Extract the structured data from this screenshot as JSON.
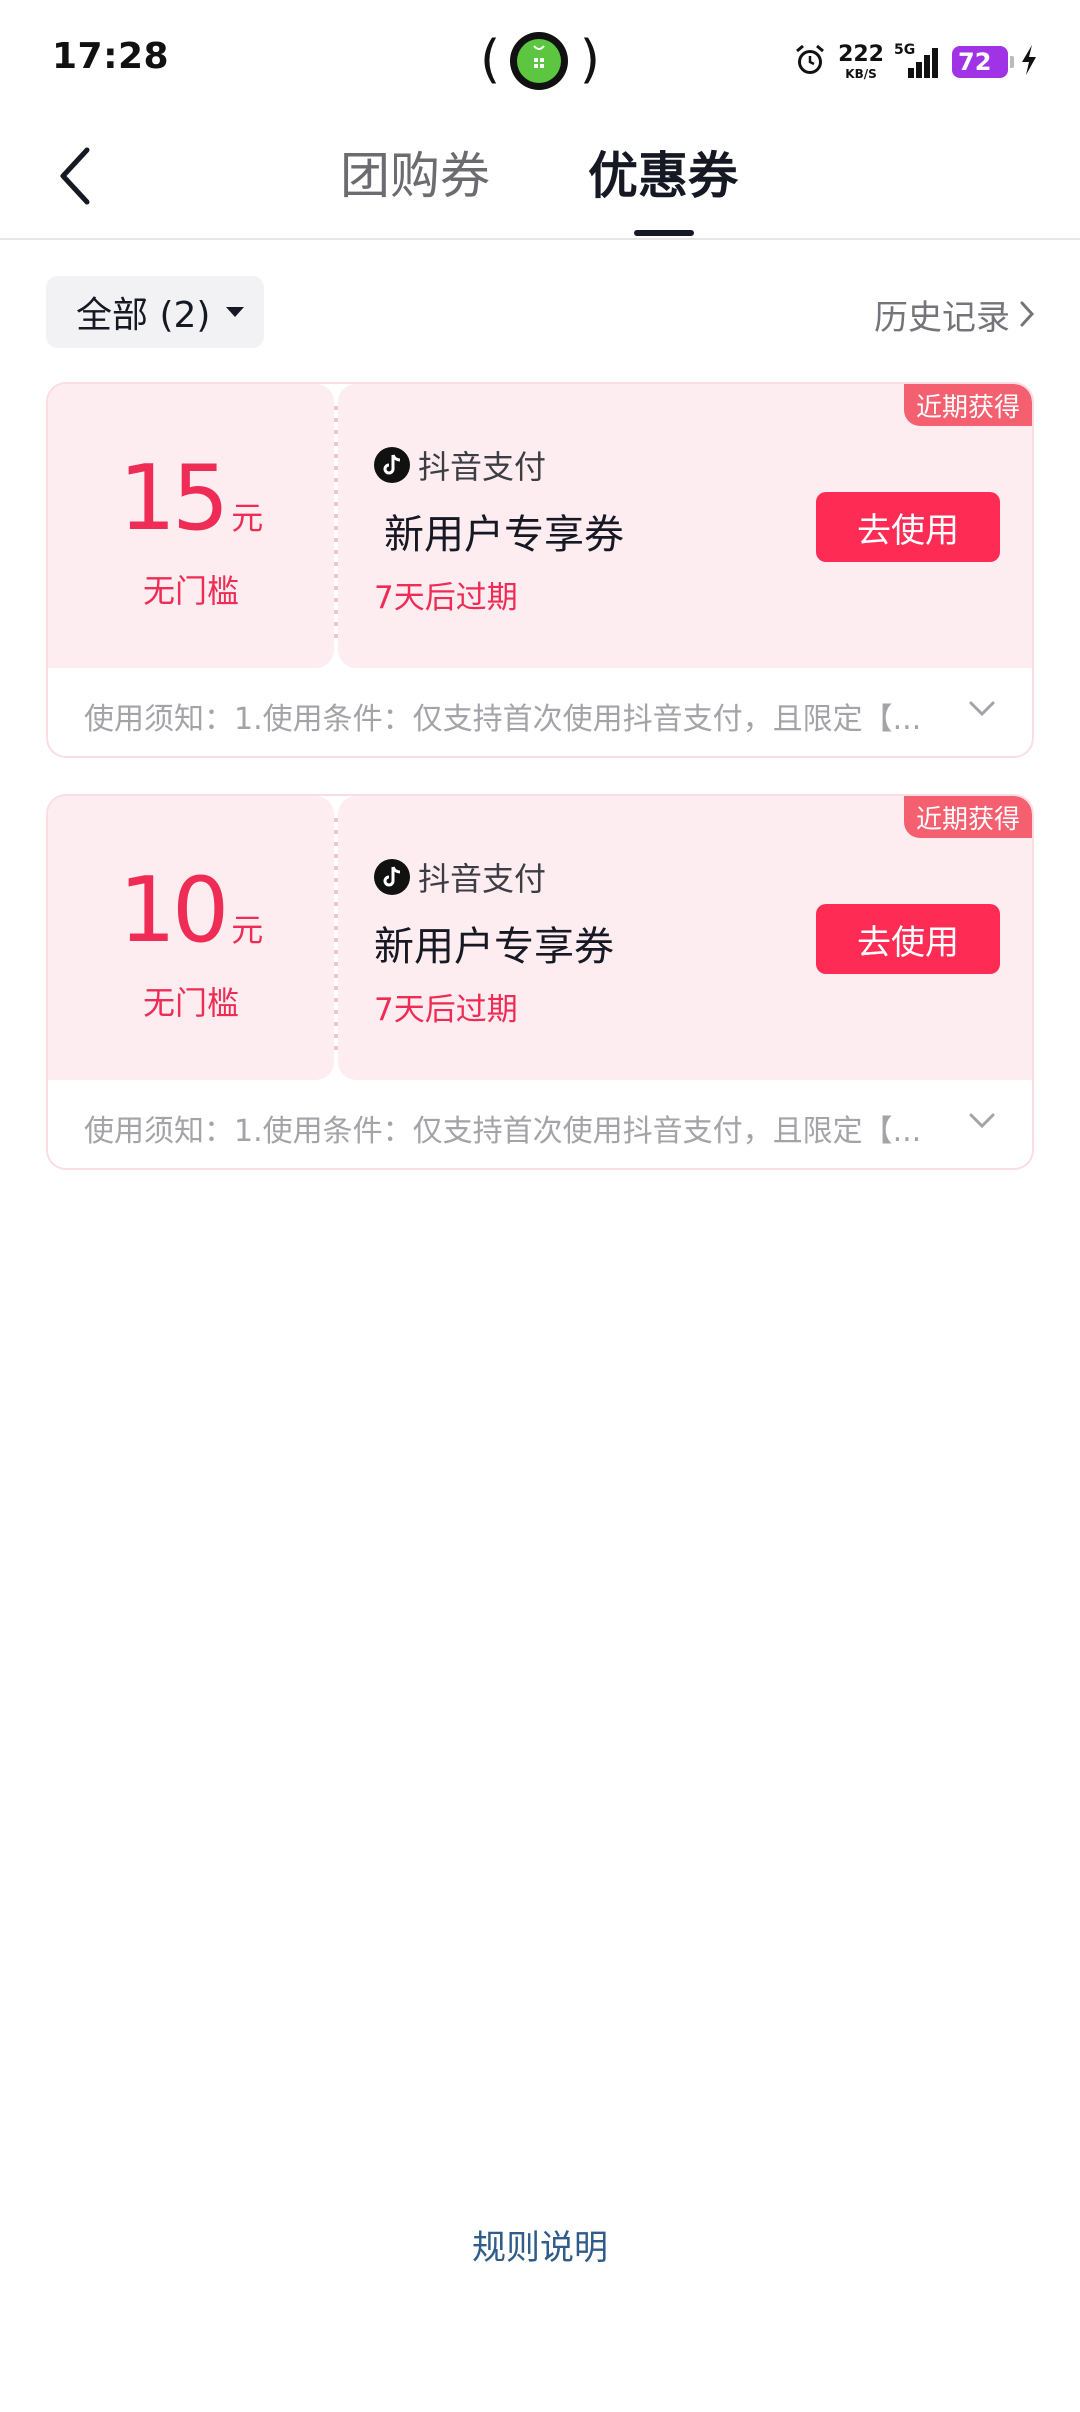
{
  "status_bar": {
    "time": "17:28",
    "net_speed": "222",
    "net_unit": "KB/S",
    "network": "5G",
    "battery": "72",
    "icons": [
      "alarm-icon",
      "signal-icon",
      "battery-icon",
      "charging-icon"
    ]
  },
  "nav": {
    "back_icon": "chevron-left-icon",
    "tabs": [
      {
        "label": "团购券",
        "active": false
      },
      {
        "label": "优惠券",
        "active": true
      }
    ]
  },
  "filter": {
    "label": "全部 (2)",
    "history_label": "历史记录"
  },
  "coupons": [
    {
      "amount": "15",
      "unit": "元",
      "threshold": "无门槛",
      "provider": "抖音支付",
      "title": "新用户专享券",
      "expiry": "7天后过期",
      "button": "去使用",
      "badge": "近期获得",
      "notice": "使用须知：1.使用条件：仅支持首次使用抖音支付，且限定【..."
    },
    {
      "amount": "10",
      "unit": "元",
      "threshold": "无门槛",
      "provider": "抖音支付",
      "title": "新用户专享券",
      "expiry": "7天后过期",
      "button": "去使用",
      "badge": "近期获得",
      "notice": "使用须知：1.使用条件：仅支持首次使用抖音支付，且限定【..."
    }
  ],
  "footer": {
    "rules_label": "规则说明"
  },
  "colors": {
    "accent": "#fe2c55",
    "coupon_bg": "#fdedf1",
    "badge": "#f4606f",
    "rules_link": "#2f5c88",
    "battery": "#a033e6"
  }
}
